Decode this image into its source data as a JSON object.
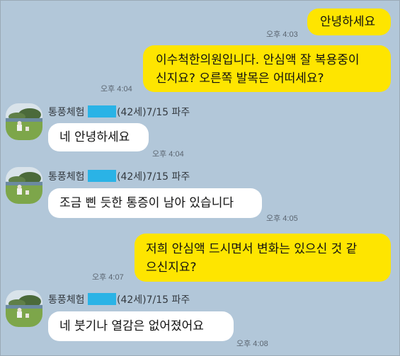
{
  "colors": {
    "background": "#b2c7d9",
    "my_bubble": "#fee500",
    "their_bubble": "#ffffff",
    "redaction": "#2ab3e6"
  },
  "messages": [
    {
      "from": "me",
      "text": "안녕하세요",
      "time": "오후 4:03"
    },
    {
      "from": "me",
      "lines": [
        "이수척한의원입니다. 안심액 잘 복용중이",
        "신지요? 오른쪽 발목은 어떠세요?"
      ],
      "time": "오후 4:04"
    },
    {
      "from": "them",
      "sender_suffix": "(42세)7/15 파주",
      "text": "네 안녕하세요",
      "time": "오후 4:04"
    },
    {
      "from": "them",
      "sender_suffix": "(42세)7/15 파주",
      "text": "조금 삔 듯한 통증이 남아 있습니다",
      "time": "오후 4:05"
    },
    {
      "from": "me",
      "lines": [
        "저희 안심액 드시면서 변화는 있으신 것 같",
        "으신지요?"
      ],
      "time": "오후 4:07"
    },
    {
      "from": "them",
      "sender_suffix": "(42세)7/15 파주",
      "text": "네 붓기나 열감은 없어졌어요",
      "time": "오후 4:08"
    }
  ],
  "sender_prefix": "통풍체험"
}
